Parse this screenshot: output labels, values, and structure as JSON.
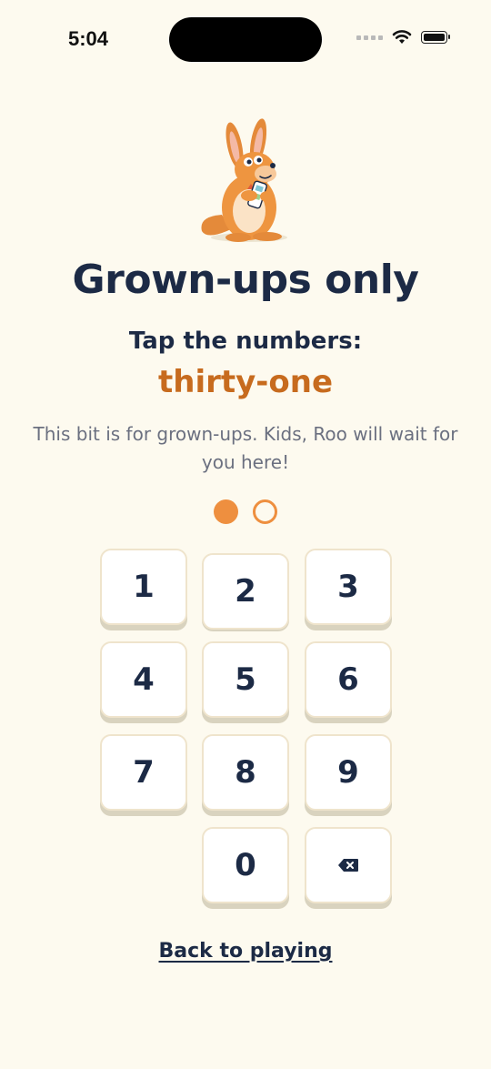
{
  "status_bar": {
    "time": "5:04",
    "icons": [
      "cellular-signal-icon",
      "wifi-icon",
      "battery-icon"
    ]
  },
  "mascot": {
    "icon": "kangaroo-mascot-icon"
  },
  "title": "Grown-ups only",
  "prompt": "Tap the numbers:",
  "target_number": "thirty-one",
  "note": "This bit is for grown-ups. Kids, Roo will wait for you here!",
  "progress": {
    "entered": 1,
    "total": 2
  },
  "keypad": {
    "keys": [
      "1",
      "2",
      "3",
      "4",
      "5",
      "6",
      "7",
      "8",
      "9",
      "0"
    ],
    "backspace_icon": "backspace-icon",
    "pressed_key": "2"
  },
  "back_link": "Back to playing",
  "colors": {
    "background": "#fdfaef",
    "accent": "#ee8f3f",
    "target_text": "#c76b1e",
    "text": "#1c2a45"
  }
}
